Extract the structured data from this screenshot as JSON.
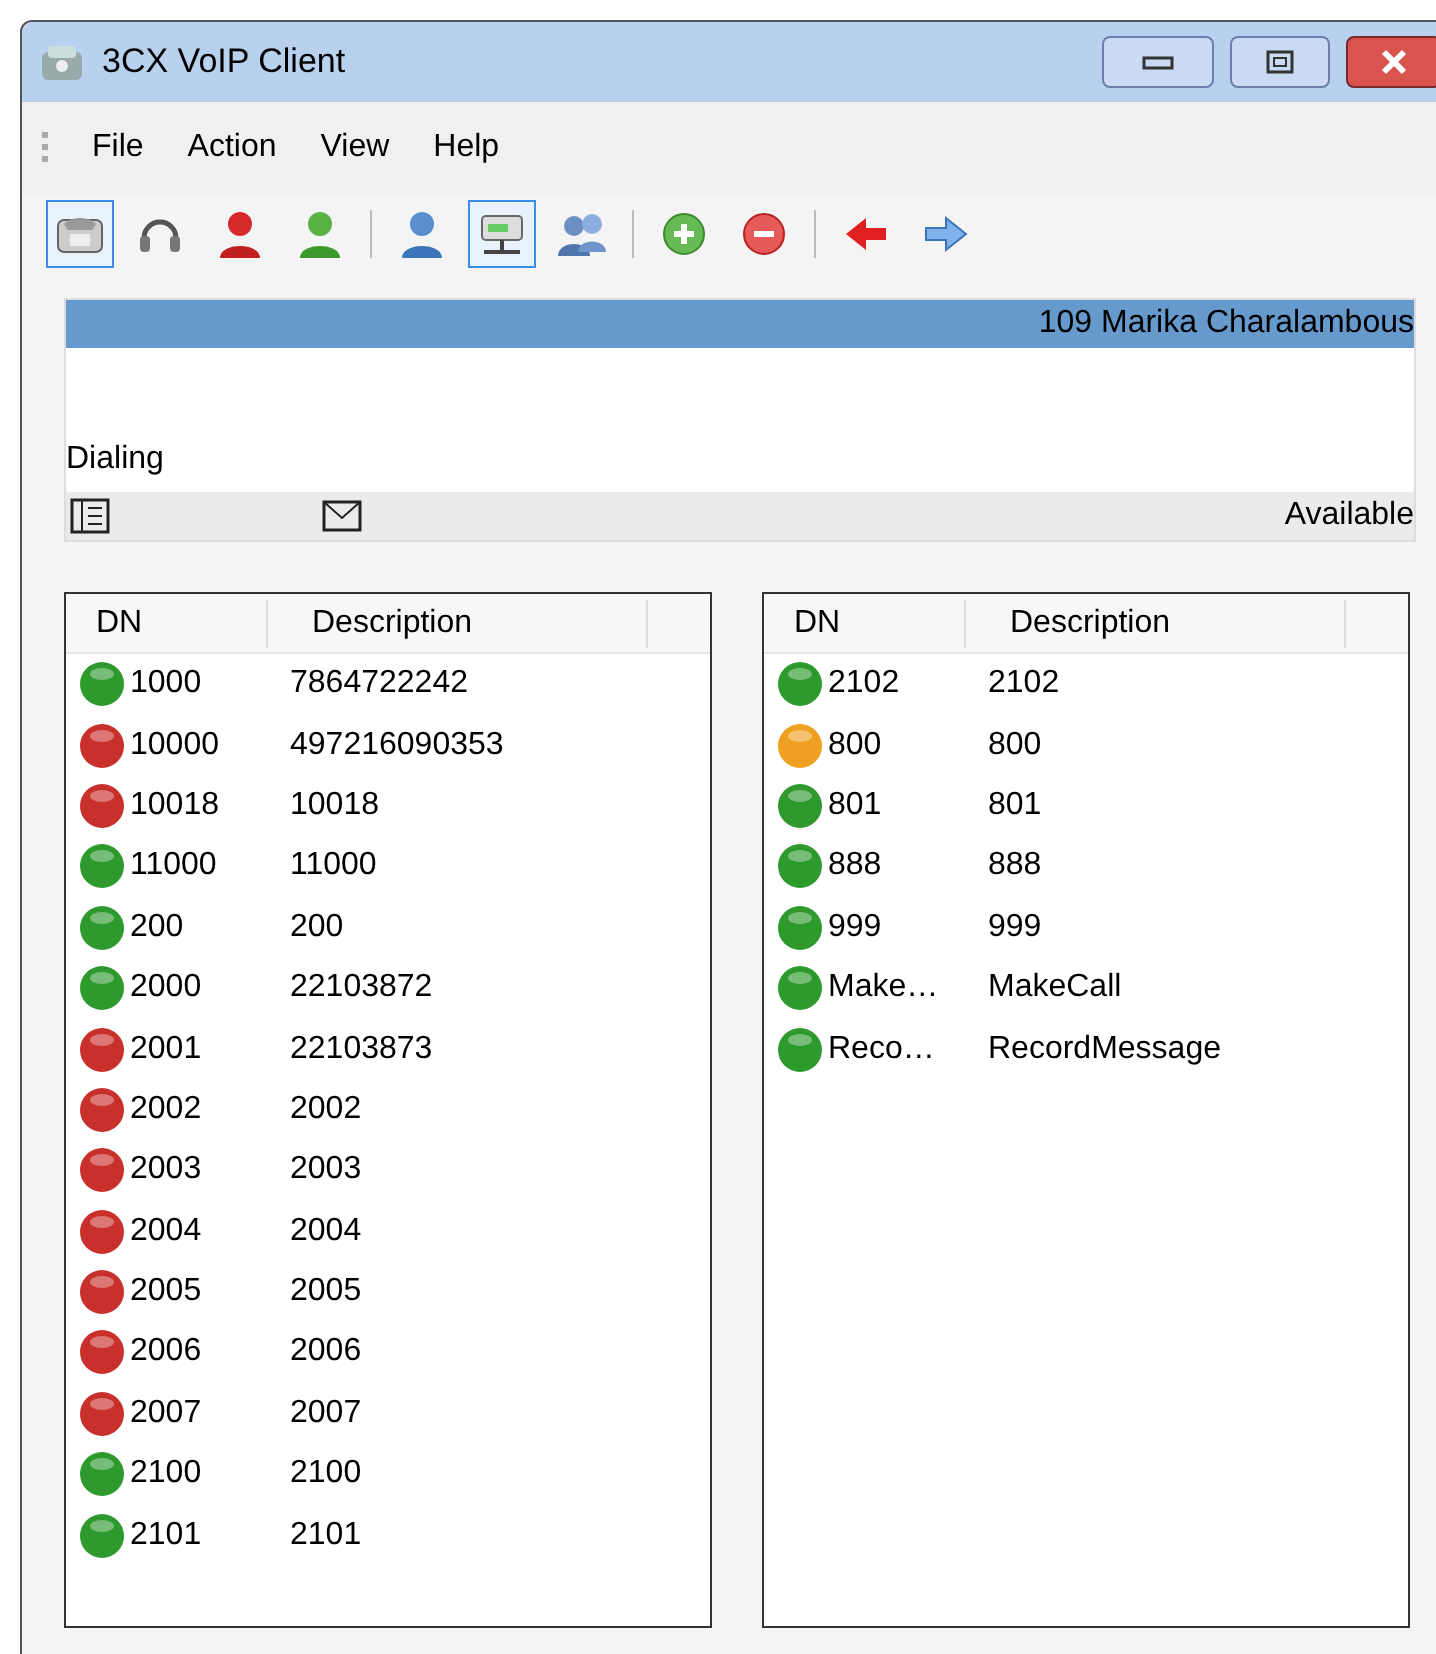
{
  "window": {
    "title": "3CX VoIP Client"
  },
  "menu": [
    {
      "label": "File"
    },
    {
      "label": "Action"
    },
    {
      "label": "View"
    },
    {
      "label": "Help"
    }
  ],
  "toolbar": [
    {
      "kind": "phone",
      "selected": true
    },
    {
      "kind": "headset",
      "selected": false
    },
    {
      "kind": "person-red",
      "selected": false
    },
    {
      "kind": "person-green",
      "selected": false
    },
    {
      "kind": "separator"
    },
    {
      "kind": "person-blue",
      "selected": false
    },
    {
      "kind": "network",
      "selected": true
    },
    {
      "kind": "people",
      "selected": false
    },
    {
      "kind": "separator"
    },
    {
      "kind": "add",
      "selected": false
    },
    {
      "kind": "remove",
      "selected": false
    },
    {
      "kind": "separator"
    },
    {
      "kind": "arrow-left",
      "selected": false
    },
    {
      "kind": "arrow-right",
      "selected": false
    }
  ],
  "call_panel": {
    "caller": "109 Marika Charalambous",
    "state": "Dialing",
    "presence": "Available"
  },
  "lists": [
    {
      "columns": [
        "DN",
        "Description"
      ],
      "rows": [
        {
          "dn": "1000",
          "description": "7864722242",
          "color": "#2e9a2e"
        },
        {
          "dn": "10000",
          "description": "497216090353",
          "color": "#c8302c"
        },
        {
          "dn": "10018",
          "description": "10018",
          "color": "#c8302c"
        },
        {
          "dn": "11000",
          "description": "11000",
          "color": "#2e9a2e"
        },
        {
          "dn": "200",
          "description": "200",
          "color": "#2e9a2e"
        },
        {
          "dn": "2000",
          "description": "22103872",
          "color": "#2e9a2e"
        },
        {
          "dn": "2001",
          "description": "22103873",
          "color": "#c8302c"
        },
        {
          "dn": "2002",
          "description": "2002",
          "color": "#c8302c"
        },
        {
          "dn": "2003",
          "description": "2003",
          "color": "#c8302c"
        },
        {
          "dn": "2004",
          "description": "2004",
          "color": "#c8302c"
        },
        {
          "dn": "2005",
          "description": "2005",
          "color": "#c8302c"
        },
        {
          "dn": "2006",
          "description": "2006",
          "color": "#c8302c"
        },
        {
          "dn": "2007",
          "description": "2007",
          "color": "#c8302c"
        },
        {
          "dn": "2100",
          "description": "2100",
          "color": "#2e9a2e"
        },
        {
          "dn": "2101",
          "description": "2101",
          "color": "#2e9a2e"
        }
      ]
    },
    {
      "columns": [
        "DN",
        "Description"
      ],
      "rows": [
        {
          "dn": "2102",
          "description": "2102",
          "color": "#2e9a2e"
        },
        {
          "dn": "800",
          "description": "800",
          "color": "#f0a020"
        },
        {
          "dn": "801",
          "description": "801",
          "color": "#2e9a2e"
        },
        {
          "dn": "888",
          "description": "888",
          "color": "#2e9a2e"
        },
        {
          "dn": "999",
          "description": "999",
          "color": "#2e9a2e"
        },
        {
          "dn": "Make…",
          "description": "MakeCall",
          "color": "#2e9a2e"
        },
        {
          "dn": "Reco…",
          "description": "RecordMessage",
          "color": "#2e9a2e"
        }
      ]
    }
  ]
}
